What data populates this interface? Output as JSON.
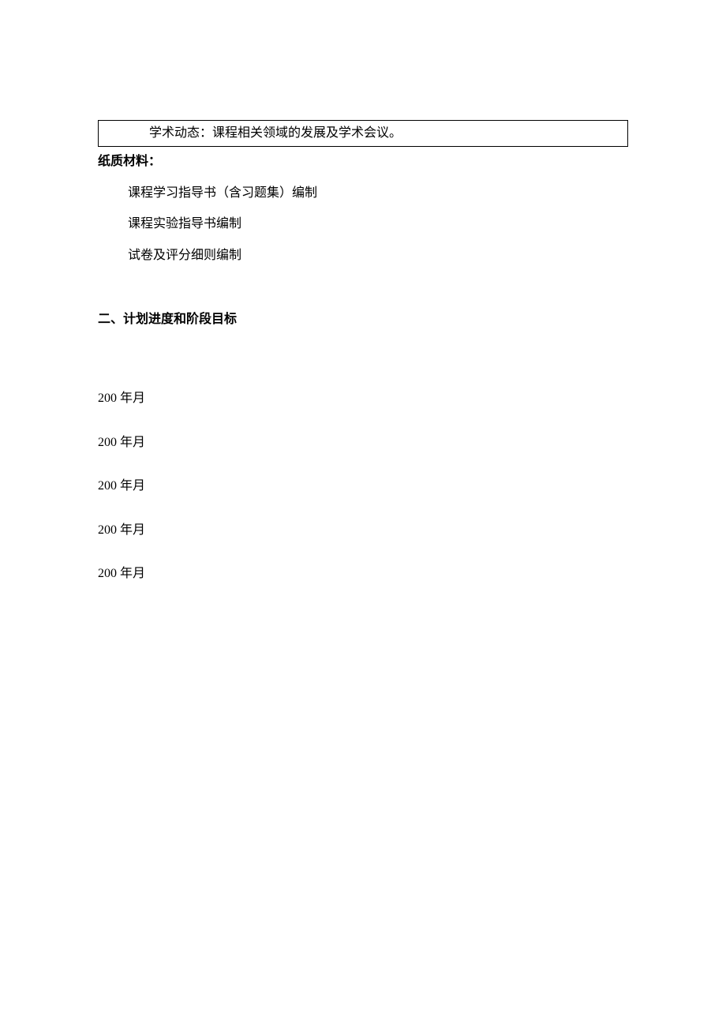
{
  "box": {
    "text": "学术动态：课程相关领域的发展及学术会议。"
  },
  "materials": {
    "header": "纸质材料：",
    "items": [
      "课程学习指导书（含习题集）编制",
      "课程实验指导书编制",
      "试卷及评分细则编制"
    ]
  },
  "section2": {
    "title": "二、计划进度和阶段目标",
    "dates": [
      "200 年月",
      "200 年月",
      "200 年月",
      "200 年月",
      "200 年月"
    ]
  }
}
